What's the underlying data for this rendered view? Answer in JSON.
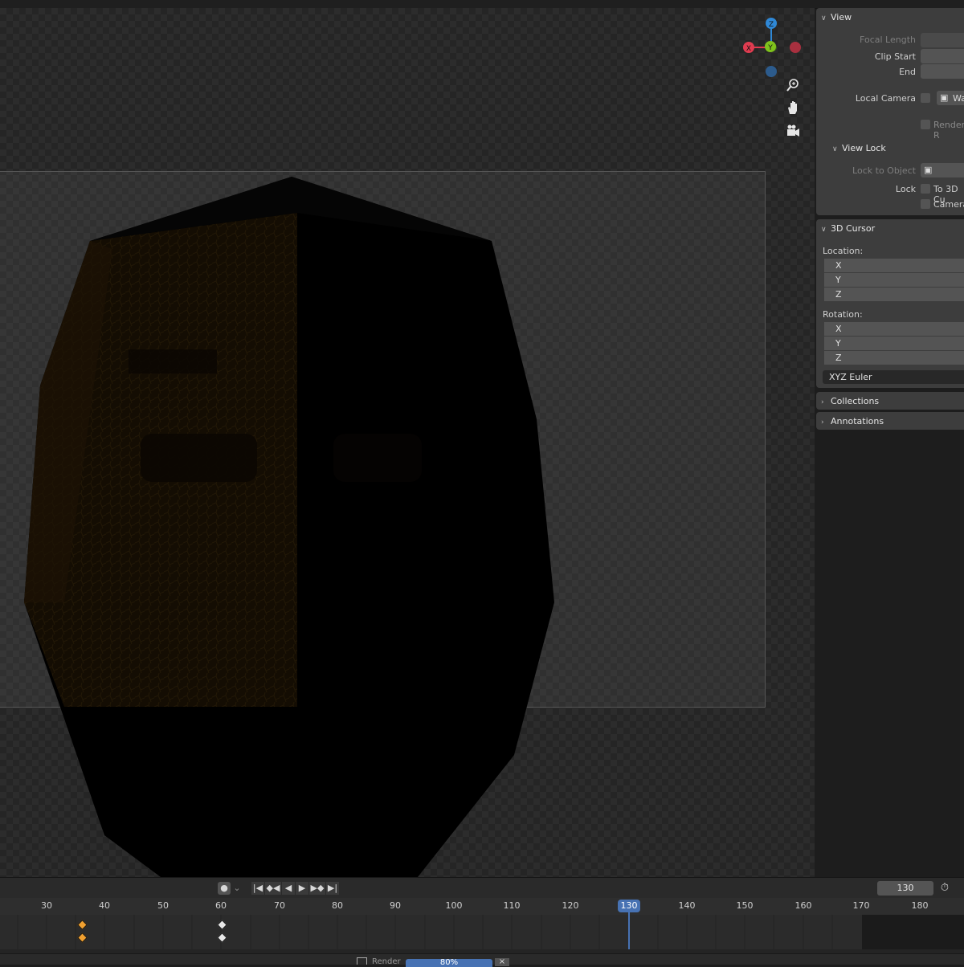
{
  "viewport": {
    "gizmo": {
      "x": "X",
      "y": "Y",
      "z": "Z"
    },
    "nav_icons": [
      "zoom-icon",
      "hand-pan-icon",
      "camera-view-icon"
    ]
  },
  "sidebar": {
    "view": {
      "header": "View",
      "focal_length_label": "Focal Length",
      "clip_start_label": "Clip Start",
      "end_label": "End",
      "local_camera_label": "Local Camera",
      "local_camera_value": "Wa",
      "render_region_label": "Render R",
      "view_lock": {
        "header": "View Lock",
        "lock_to_object_label": "Lock to Object",
        "lock_label": "Lock",
        "to_3d_cursor_label": "To 3D Cu",
        "camera_label": "Camera"
      }
    },
    "cursor": {
      "header": "3D Cursor",
      "location_label": "Location:",
      "location": [
        "X",
        "Y",
        "Z"
      ],
      "rotation_label": "Rotation:",
      "rotation": [
        "X",
        "Y",
        "Z"
      ],
      "rotation_mode": "XYZ Euler"
    },
    "collections": {
      "header": "Collections"
    },
    "annotations": {
      "header": "Annotations"
    }
  },
  "timeline": {
    "current_frame": "130",
    "frame_field": "130",
    "ticks": [
      "30",
      "40",
      "50",
      "60",
      "70",
      "80",
      "90",
      "100",
      "110",
      "120",
      "130",
      "140",
      "150",
      "160",
      "170",
      "180"
    ],
    "transport": {
      "record": "●",
      "jump_start": "|◀",
      "prev_key": "◆◀",
      "play_reverse": "◀",
      "play": "▶",
      "next_key": "▶◆",
      "jump_end": "▶|"
    }
  },
  "statusbar": {
    "label": "Render",
    "progress_text": "80%",
    "progress": 0.8,
    "cancel": "×"
  },
  "colors": {
    "accent": "#4772b3",
    "axis_x": "#e03c50",
    "axis_y": "#7fc21c",
    "axis_z": "#2f88d6",
    "keyframe_selected": "#f0a030"
  }
}
